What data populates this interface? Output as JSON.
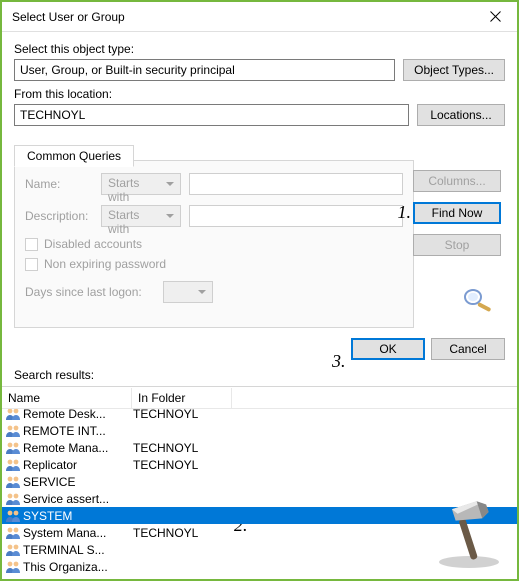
{
  "window": {
    "title": "Select User or Group"
  },
  "object_type": {
    "label": "Select this object type:",
    "value": "User, Group, or Built-in security principal",
    "button": "Object Types..."
  },
  "location": {
    "label": "From this location:",
    "value": "TECHNOYL",
    "button": "Locations..."
  },
  "tab": {
    "label": "Common Queries"
  },
  "queries": {
    "name_label": "Name:",
    "desc_label": "Description:",
    "starts_with": "Starts with",
    "cb_disabled": "Disabled accounts",
    "cb_nonexp": "Non expiring password",
    "days_label": "Days since last logon:"
  },
  "side": {
    "columns": "Columns...",
    "find_now": "Find Now",
    "stop": "Stop"
  },
  "bottom": {
    "ok": "OK",
    "cancel": "Cancel"
  },
  "annotations": {
    "a1": "1.",
    "a2": "2.",
    "a3": "3."
  },
  "results": {
    "label": "Search results:",
    "headers": {
      "name": "Name",
      "folder": "In Folder"
    },
    "rows": [
      {
        "name": "Remote Desk...",
        "folder": "TECHNOYL",
        "selected": false
      },
      {
        "name": "REMOTE INT...",
        "folder": "",
        "selected": false
      },
      {
        "name": "Remote Mana...",
        "folder": "TECHNOYL",
        "selected": false
      },
      {
        "name": "Replicator",
        "folder": "TECHNOYL",
        "selected": false
      },
      {
        "name": "SERVICE",
        "folder": "",
        "selected": false
      },
      {
        "name": "Service assert...",
        "folder": "",
        "selected": false
      },
      {
        "name": "SYSTEM",
        "folder": "",
        "selected": true
      },
      {
        "name": "System Mana...",
        "folder": "TECHNOYL",
        "selected": false
      },
      {
        "name": "TERMINAL S...",
        "folder": "",
        "selected": false
      },
      {
        "name": "This Organiza...",
        "folder": "",
        "selected": false
      }
    ]
  }
}
